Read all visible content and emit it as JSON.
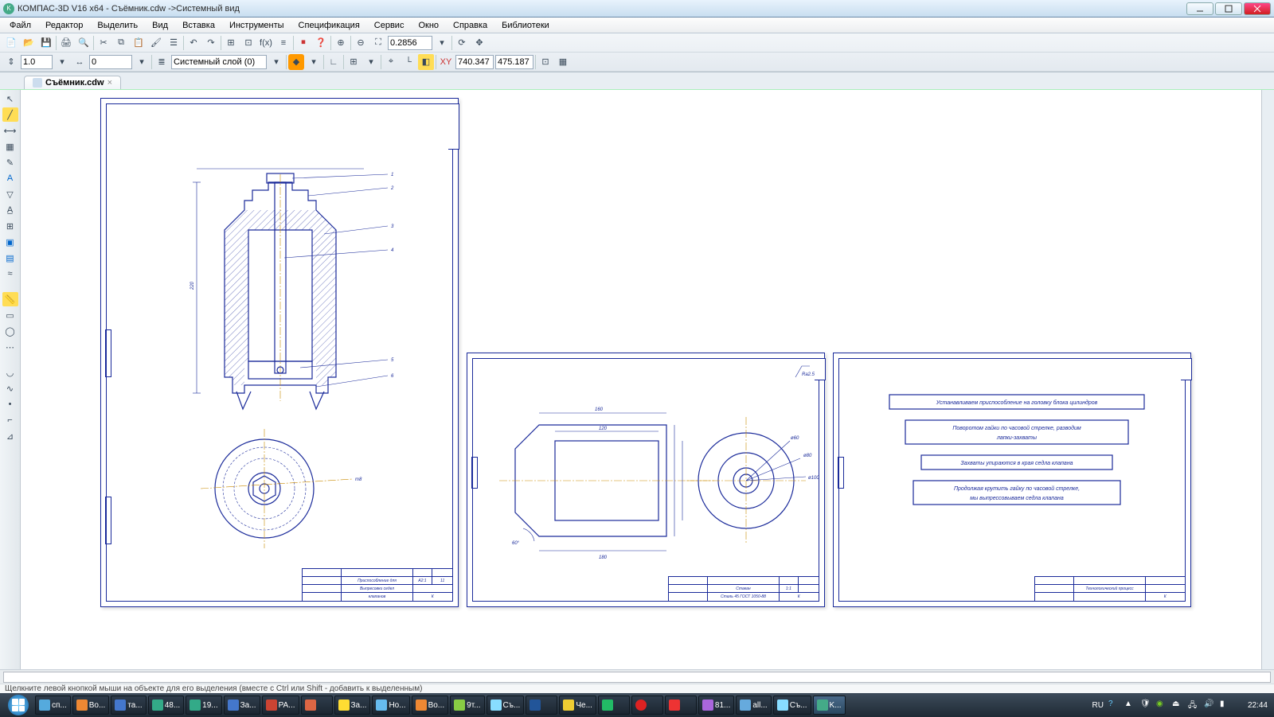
{
  "app": {
    "title": "КОМПАС-3D V16  x64 - Съёмник.cdw ->Системный вид"
  },
  "menu": [
    "Файл",
    "Редактор",
    "Выделить",
    "Вид",
    "Вставка",
    "Инструменты",
    "Спецификация",
    "Сервис",
    "Окно",
    "Справка",
    "Библиотеки"
  ],
  "toolbar": {
    "zoom": "0.2856",
    "scale": "1.0",
    "offset": "0",
    "layer": "Системный слой (0)",
    "coord_x": "740.347",
    "coord_y": "475.187",
    "fx_label": "f(x)"
  },
  "doctab": {
    "name": "Съёмник.cdw"
  },
  "status": {
    "hint": "Щелкните левой кнопкой мыши на объекте для его выделения (вместе с Ctrl или Shift - добавить к выделенным)"
  },
  "sheet1": {
    "tb_title1": "Приспособление для",
    "tb_title2": "Выпресовки седел",
    "tb_title3": "клапанов",
    "tb_scale": "А2:1",
    "tb_page": "11",
    "tb_fmt": "К",
    "dim_220": "220",
    "dim_m8": "m8",
    "leaders": [
      "1",
      "2",
      "3",
      "4",
      "5",
      "6"
    ]
  },
  "sheet2": {
    "tb_title": "Стакан",
    "tb_mat": "Сталь 45 ГОСТ 1050-88",
    "tb_scale": "1:1",
    "tb_fmt": "К",
    "dim_160": "160",
    "dim_120": "120",
    "dim_180": "180",
    "dim_60": "60°",
    "dim_Ra": "Ra2.5",
    "dim_d1": "ø60",
    "dim_d2": "ø100"
  },
  "sheet3": {
    "tb_title": "Технологический процесс",
    "box1": "Устанавливаем приспособление на головку блока цилиндров",
    "box2a": "Поворотом гайки по часовой стрелке, разводим",
    "box2b": "лапки-захваты",
    "box3": "Захваты упираются в края седла клапана",
    "box4a": "Продолжая крутить гайку по часовой стрелке,",
    "box4b": "мы выпрессовываем седла клапана",
    "tb_fmt": "К"
  },
  "taskbar": {
    "items": [
      "сп...",
      "Во...",
      "та...",
      "48...",
      "19...",
      "За...",
      "PA...",
      "",
      "За...",
      "Но...",
      "Во...",
      "9т...",
      "Съ...",
      "",
      "Че...",
      "",
      "",
      "",
      "81...",
      "all...",
      "Съ...",
      "K..."
    ],
    "lang": "RU",
    "clock": "22:44"
  }
}
